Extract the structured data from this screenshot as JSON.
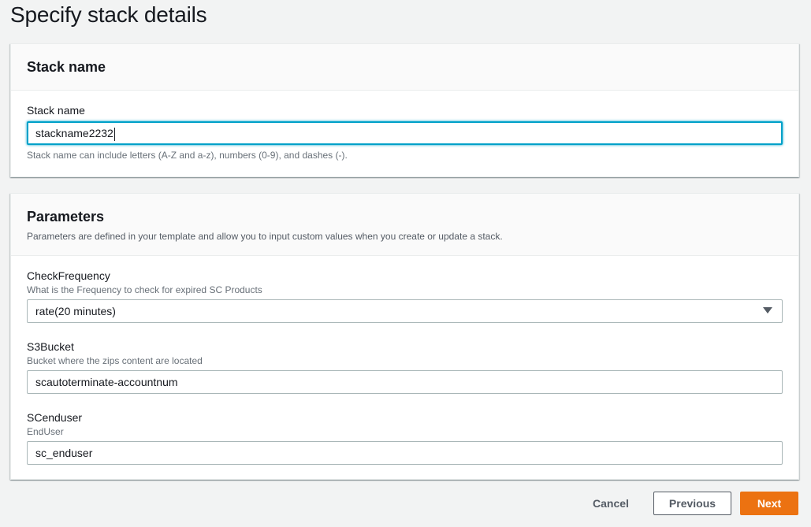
{
  "page": {
    "title": "Specify stack details"
  },
  "stack_name_panel": {
    "title": "Stack name",
    "field": {
      "label": "Stack name",
      "value": "stackname2232",
      "constraint": "Stack name can include letters (A-Z and a-z), numbers (0-9), and dashes (-)."
    }
  },
  "parameters_panel": {
    "title": "Parameters",
    "description": "Parameters are defined in your template and allow you to input custom values when you create or update a stack.",
    "params": [
      {
        "label": "CheckFrequency",
        "description": "What is the Frequency to check for expired SC Products",
        "value": "rate(20 minutes)",
        "control": "select"
      },
      {
        "label": "S3Bucket",
        "description": "Bucket where the zips content are located",
        "value": "scautoterminate-accountnum",
        "control": "text"
      },
      {
        "label": "SCenduser",
        "description": "EndUser",
        "value": "sc_enduser",
        "control": "text"
      }
    ]
  },
  "footer": {
    "cancel_label": "Cancel",
    "previous_label": "Previous",
    "next_label": "Next"
  },
  "colors": {
    "primary_button": "#ec7211",
    "focus_ring": "#00a1c9",
    "background": "#f2f3f3"
  },
  "icons": {
    "select_arrow": "caret-down-icon"
  }
}
